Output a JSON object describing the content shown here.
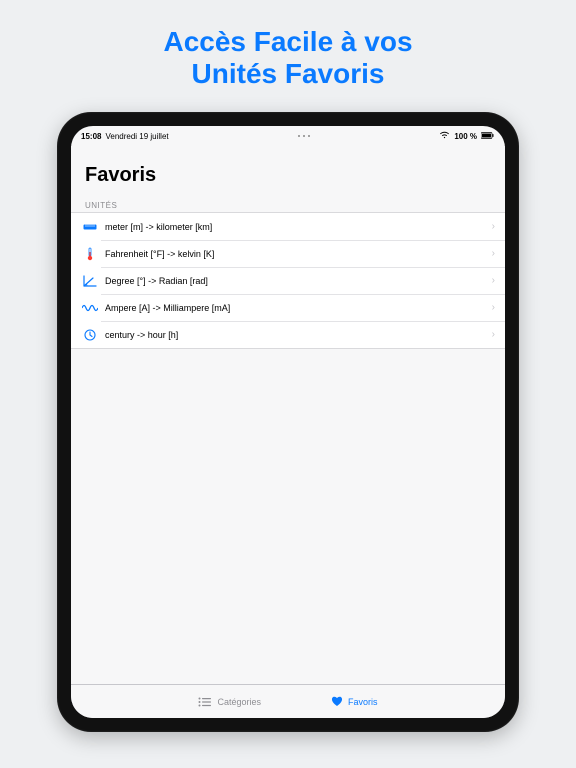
{
  "promo": {
    "line1": "Accès Facile à vos",
    "line2": "Unités Favoris"
  },
  "statusbar": {
    "time": "15:08",
    "date": "Vendredi 19 juillet",
    "battery": "100 %"
  },
  "page": {
    "title": "Favoris",
    "section_header": "UNITÉS"
  },
  "favorites": [
    {
      "icon": "ruler-icon",
      "label": "meter [m] -> kilometer [km]"
    },
    {
      "icon": "thermometer-icon",
      "label": "Fahrenheit [°F] -> kelvin [K]"
    },
    {
      "icon": "angle-icon",
      "label": "Degree [°] -> Radian [rad]"
    },
    {
      "icon": "wave-icon",
      "label": "Ampere [A] -> Milliampere [mA]"
    },
    {
      "icon": "clock-icon",
      "label": "century -> hour [h]"
    }
  ],
  "tabs": {
    "categories": "Catégories",
    "favoris": "Favoris"
  }
}
